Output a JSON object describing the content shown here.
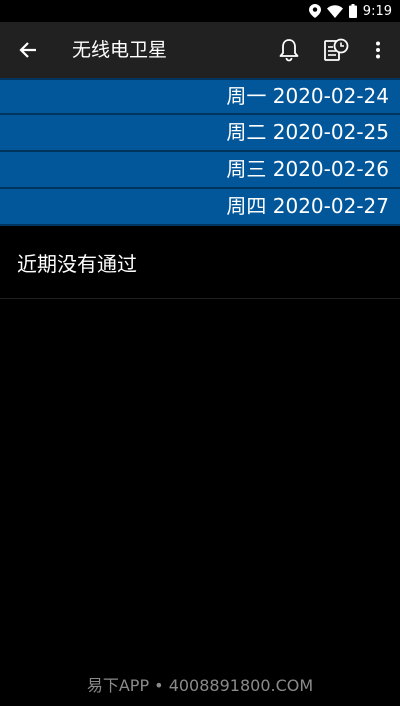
{
  "status_bar": {
    "time": "9:19"
  },
  "app_bar": {
    "title": "无线电卫星",
    "icons": [
      "arrow-back-icon",
      "bell-icon",
      "schedule-icon",
      "more-vert-icon"
    ]
  },
  "days": [
    {
      "label": "周一 2020-02-24"
    },
    {
      "label": "周二 2020-02-25"
    },
    {
      "label": "周三 2020-02-26"
    },
    {
      "label": "周四 2020-02-27"
    }
  ],
  "empty_message": "近期没有通过",
  "watermark": "易下APP • 4008891800.COM",
  "colors": {
    "app_bar": "#212121",
    "day_row": "#02579b",
    "background": "#000000"
  }
}
